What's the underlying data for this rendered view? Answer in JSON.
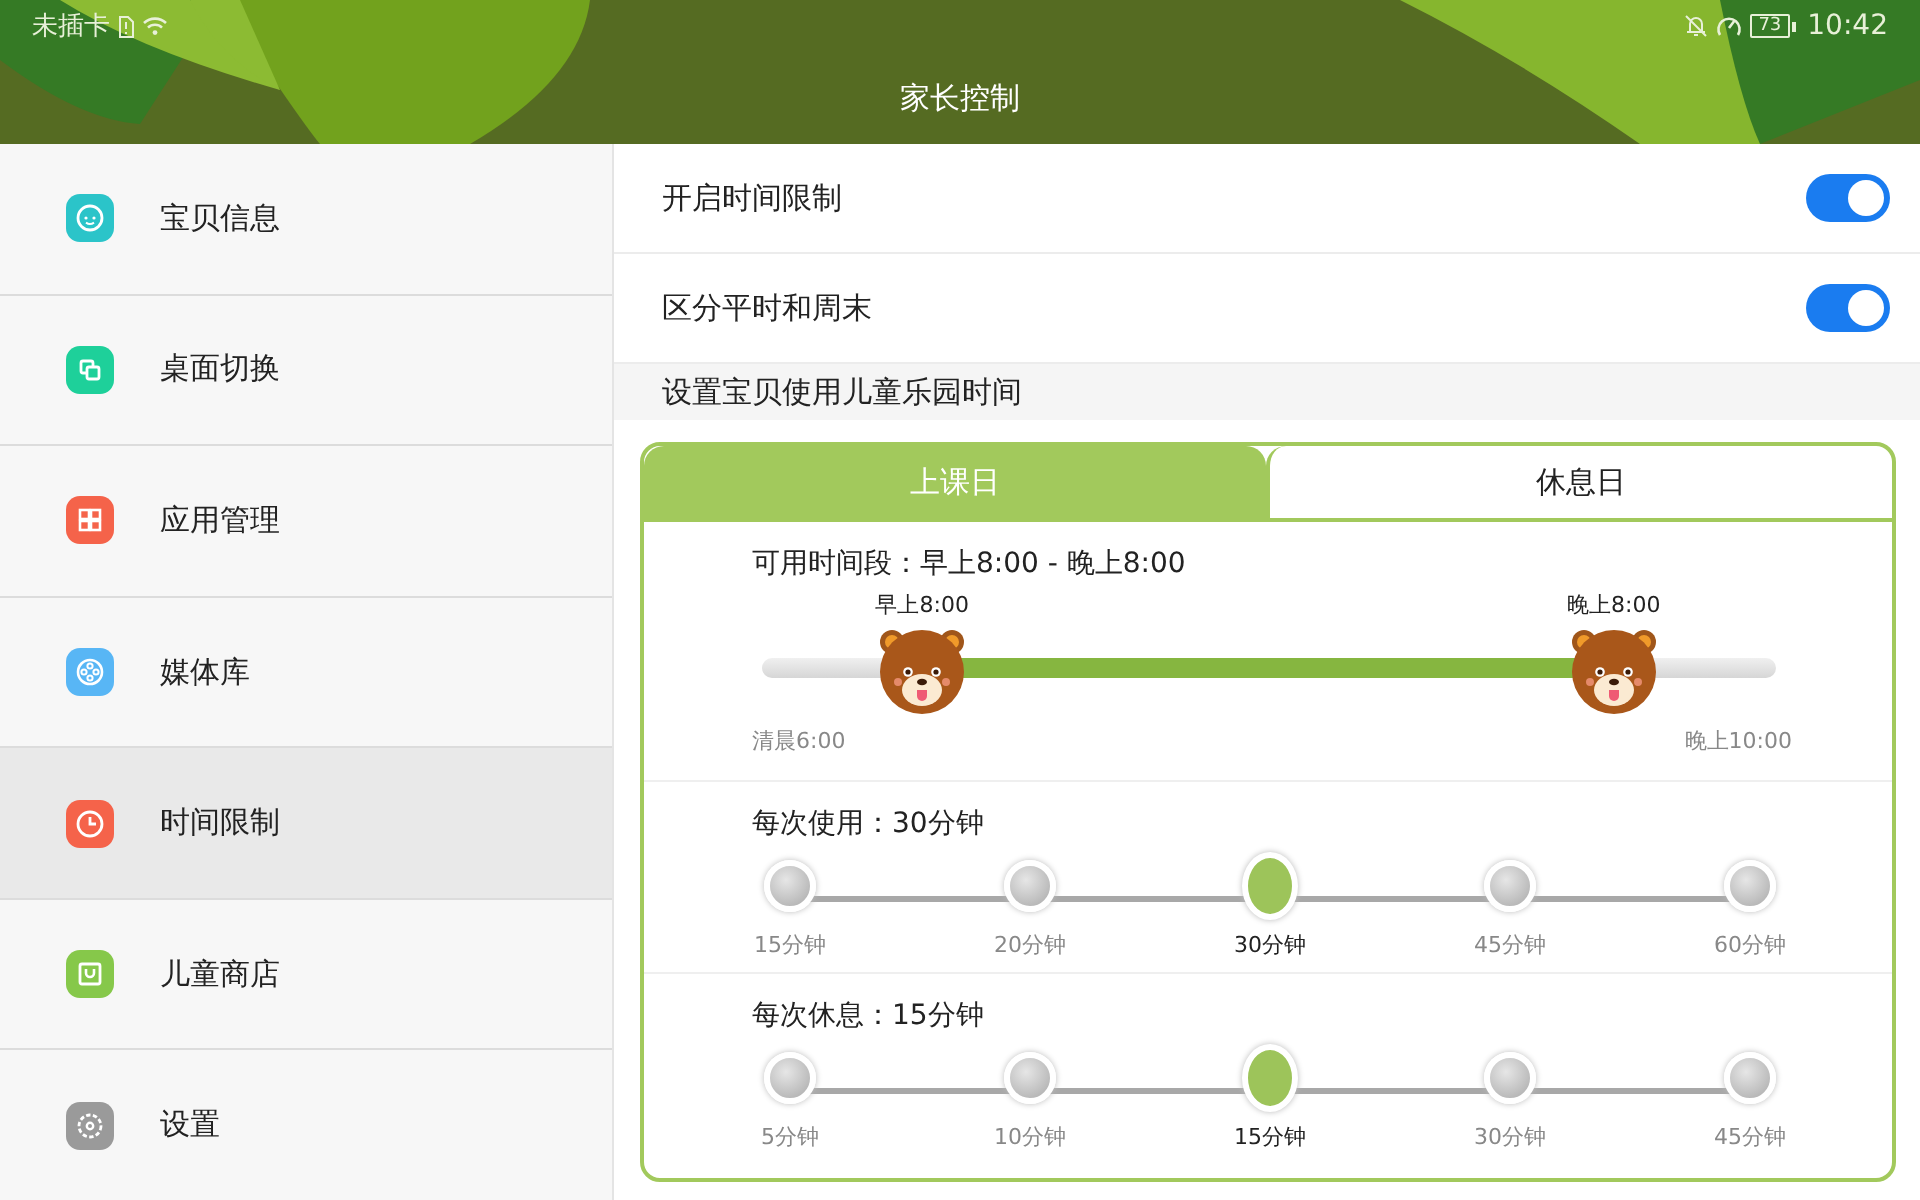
{
  "status_bar": {
    "carrier": "未插卡",
    "battery": "73",
    "time": "10:42"
  },
  "header": {
    "title": "家长控制"
  },
  "sidebar": {
    "items": [
      {
        "label": "宝贝信息",
        "kind": "face",
        "color": "#2bc4c9",
        "selected": false
      },
      {
        "label": "桌面切换",
        "kind": "switch",
        "color": "#1ed09a",
        "selected": false
      },
      {
        "label": "应用管理",
        "kind": "grid",
        "color": "#f5634a",
        "selected": false
      },
      {
        "label": "媒体库",
        "kind": "reel",
        "color": "#58b6f5",
        "selected": false
      },
      {
        "label": "时间限制",
        "kind": "clock",
        "color": "#f5634a",
        "selected": true
      },
      {
        "label": "儿童商店",
        "kind": "bag",
        "color": "#86c84a",
        "selected": false
      },
      {
        "label": "设置",
        "kind": "gear",
        "color": "#9a9a9a",
        "selected": false
      }
    ]
  },
  "settings": [
    {
      "label": "开启时间限制",
      "on": true
    },
    {
      "label": "区分平时和周末",
      "on": true
    }
  ],
  "section_title": "设置宝贝使用儿童乐园时间",
  "tabs": [
    {
      "label": "上课日",
      "selected": true
    },
    {
      "label": "休息日",
      "selected": false
    }
  ],
  "range": {
    "caption": "可用时间段：早上8:00 - 晚上8:00",
    "min_label": "清晨6:00",
    "max_label": "晚上10:00",
    "thumbs": [
      {
        "label": "早上8:00",
        "level": 0.158
      },
      {
        "label": "晚上8:00",
        "level": 0.84
      }
    ]
  },
  "steppers": [
    {
      "caption": "每次使用：30分钟",
      "options": [
        {
          "label": "15分钟",
          "selected": false
        },
        {
          "label": "20分钟",
          "selected": false
        },
        {
          "label": "30分钟",
          "selected": true
        },
        {
          "label": "45分钟",
          "selected": false
        },
        {
          "label": "60分钟",
          "selected": false
        }
      ]
    },
    {
      "caption": "每次休息：15分钟",
      "options": [
        {
          "label": "5分钟",
          "selected": false
        },
        {
          "label": "10分钟",
          "selected": false
        },
        {
          "label": "15分钟",
          "selected": true
        },
        {
          "label": "30分钟",
          "selected": false
        },
        {
          "label": "45分钟",
          "selected": false
        }
      ]
    }
  ]
}
